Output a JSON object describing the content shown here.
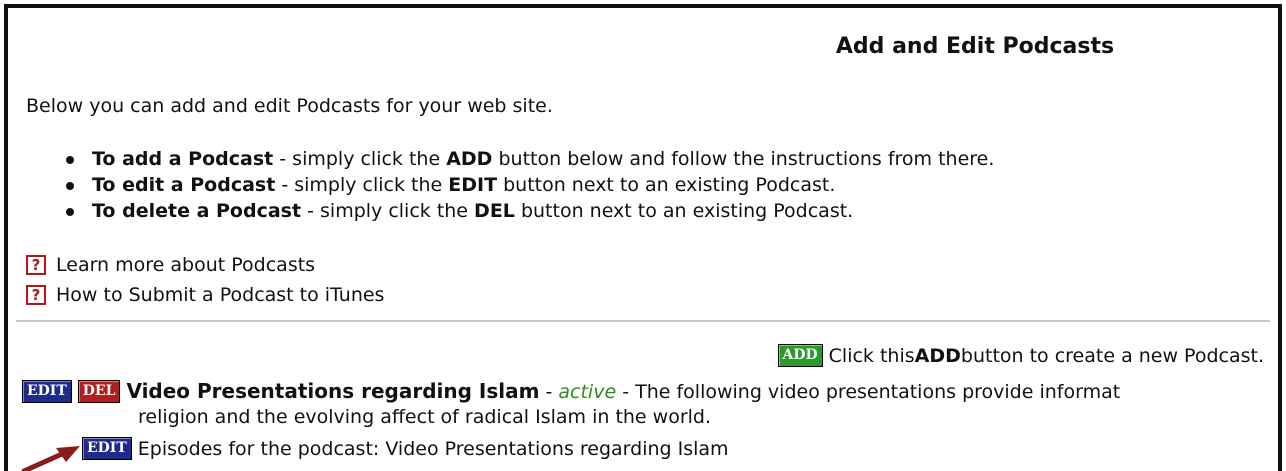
{
  "page": {
    "title": "Add and Edit Podcasts",
    "intro": "Below you can add and edit Podcasts for your web site."
  },
  "instructions": [
    {
      "bold": "To add a Podcast",
      "t1": " - simply click the ",
      "button": "ADD",
      "t2": " button below and follow the instructions from there."
    },
    {
      "bold": "To edit a Podcast",
      "t1": " - simply click the ",
      "button": "EDIT",
      "t2": " button next to an existing Podcast."
    },
    {
      "bold": "To delete a Podcast",
      "t1": " - simply click the ",
      "button": "DEL",
      "t2": " button next to an existing Podcast."
    }
  ],
  "help_links": [
    {
      "icon": "?",
      "label": "Learn more about Podcasts"
    },
    {
      "icon": "?",
      "label": "How to Submit a Podcast to iTunes"
    }
  ],
  "add_section": {
    "button_label": "ADD",
    "text_before": "Click this ",
    "text_bold": "ADD",
    "text_after": " button to create a new Podcast."
  },
  "podcast": {
    "edit_label": "EDIT",
    "del_label": "DEL",
    "name": "Video Presentations regarding Islam",
    "sep1": " - ",
    "status": "active",
    "sep2": " - ",
    "description_line1": "The following video presentations provide informat",
    "description_line2": "religion and the evolving affect of radical Islam in the world."
  },
  "episodes": {
    "edit_label": "EDIT",
    "label": "Episodes for the podcast: Video Presentations regarding Islam"
  },
  "colors": {
    "add_button": "#2a9a2a",
    "edit_button": "#1f2a8e",
    "del_button": "#b31e1e",
    "status_active": "#2e8b1e",
    "help_icon": "#b01818",
    "arrow": "#8b1a1a"
  },
  "icons": {
    "help": "help-icon",
    "annotation": "arrow-pointer-icon"
  }
}
